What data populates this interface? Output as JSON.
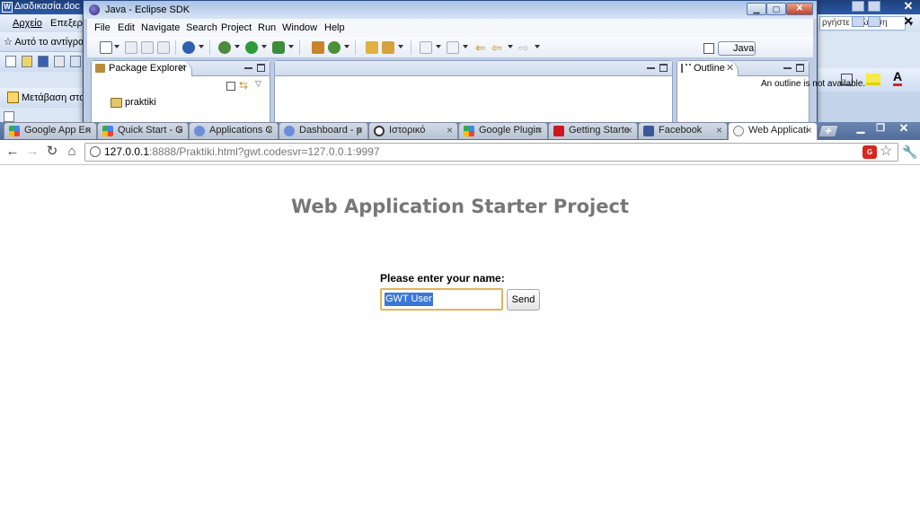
{
  "word": {
    "title": "Διαδικασία.doc -",
    "doc_icon_glyph": "W",
    "menu": [
      "Αρχείο",
      "Επεξεργ"
    ],
    "style_label": "Αυτό το αντίγρα",
    "nav_label": "Μετάβαση στο",
    "help_placeholder": "ργήστε ερώτηση"
  },
  "eclipse": {
    "title": "Java - Eclipse SDK",
    "menu": [
      "File",
      "Edit",
      "Navigate",
      "Search",
      "Project",
      "Run",
      "Window",
      "Help"
    ],
    "perspective": "Java",
    "package_explorer": {
      "tab_label": "Package Explorer",
      "project": "praktiki"
    },
    "outline": {
      "tab_label": "Outline",
      "message": "An outline is not available."
    }
  },
  "chrome": {
    "tabs": [
      {
        "label": "Google App En",
        "favicon": "google",
        "active": false
      },
      {
        "label": "Quick Start - G",
        "favicon": "google",
        "active": false
      },
      {
        "label": "Applications C",
        "favicon": "appengine",
        "active": false
      },
      {
        "label": "Dashboard - p",
        "favicon": "appengine",
        "active": false
      },
      {
        "label": "Ιστορικό",
        "favicon": "history",
        "active": false
      },
      {
        "label": "Google Plugin",
        "favicon": "google",
        "active": false
      },
      {
        "label": "Getting Starte",
        "favicon": "youtube",
        "active": false
      },
      {
        "label": "Facebook",
        "favicon": "facebook",
        "active": false
      },
      {
        "label": "Web Applicati",
        "favicon": "page",
        "active": true
      }
    ],
    "new_tab_glyph": "+",
    "url_host": "127.0.0.1",
    "url_rest": ":8888/Praktiki.html?gwt.codesvr=127.0.0.1:9997",
    "gwt_icon_text": "G"
  },
  "page": {
    "title": "Web Application Starter Project",
    "prompt": "Please enter your name:",
    "input_value": "GWT User",
    "send_label": "Send"
  },
  "colors": {
    "selection": "#3a78d8",
    "input_focus_border": "#e3b35b",
    "title_gray": "#777777",
    "youtube_red": "#cc181e",
    "facebook_blue": "#3b5998"
  }
}
